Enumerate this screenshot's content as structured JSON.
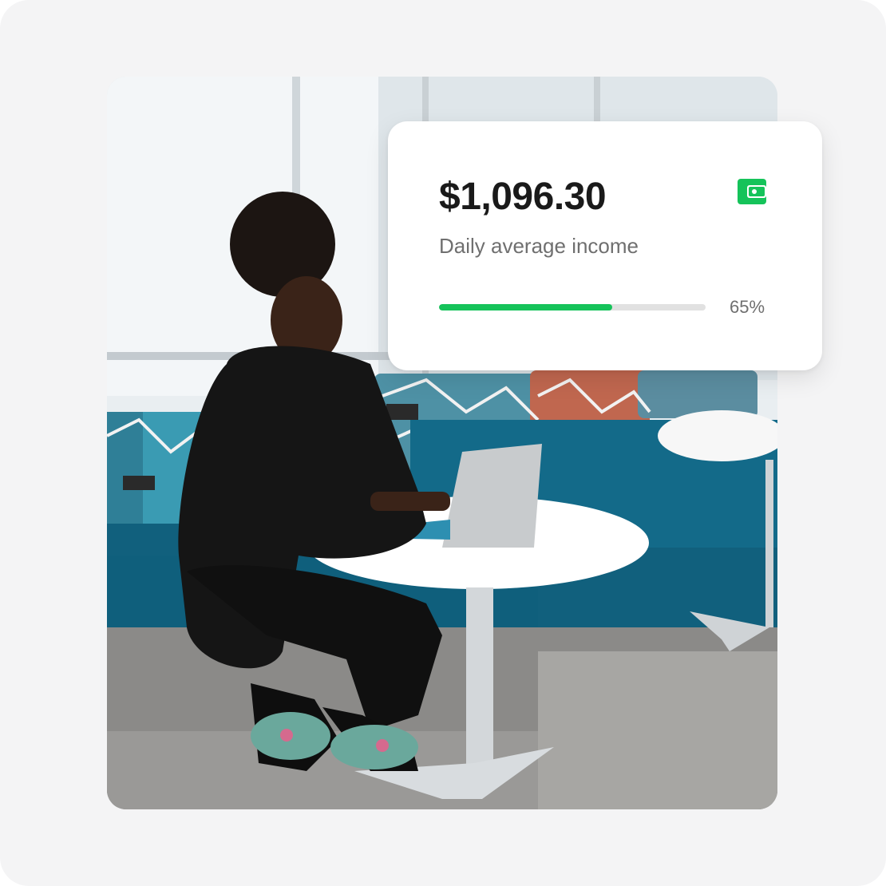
{
  "income_card": {
    "amount": "$1,096.30",
    "label": "Daily average income",
    "progress_percent": 65,
    "progress_text": "65%",
    "icon": "wallet-icon",
    "accent_color": "#15c35a"
  }
}
